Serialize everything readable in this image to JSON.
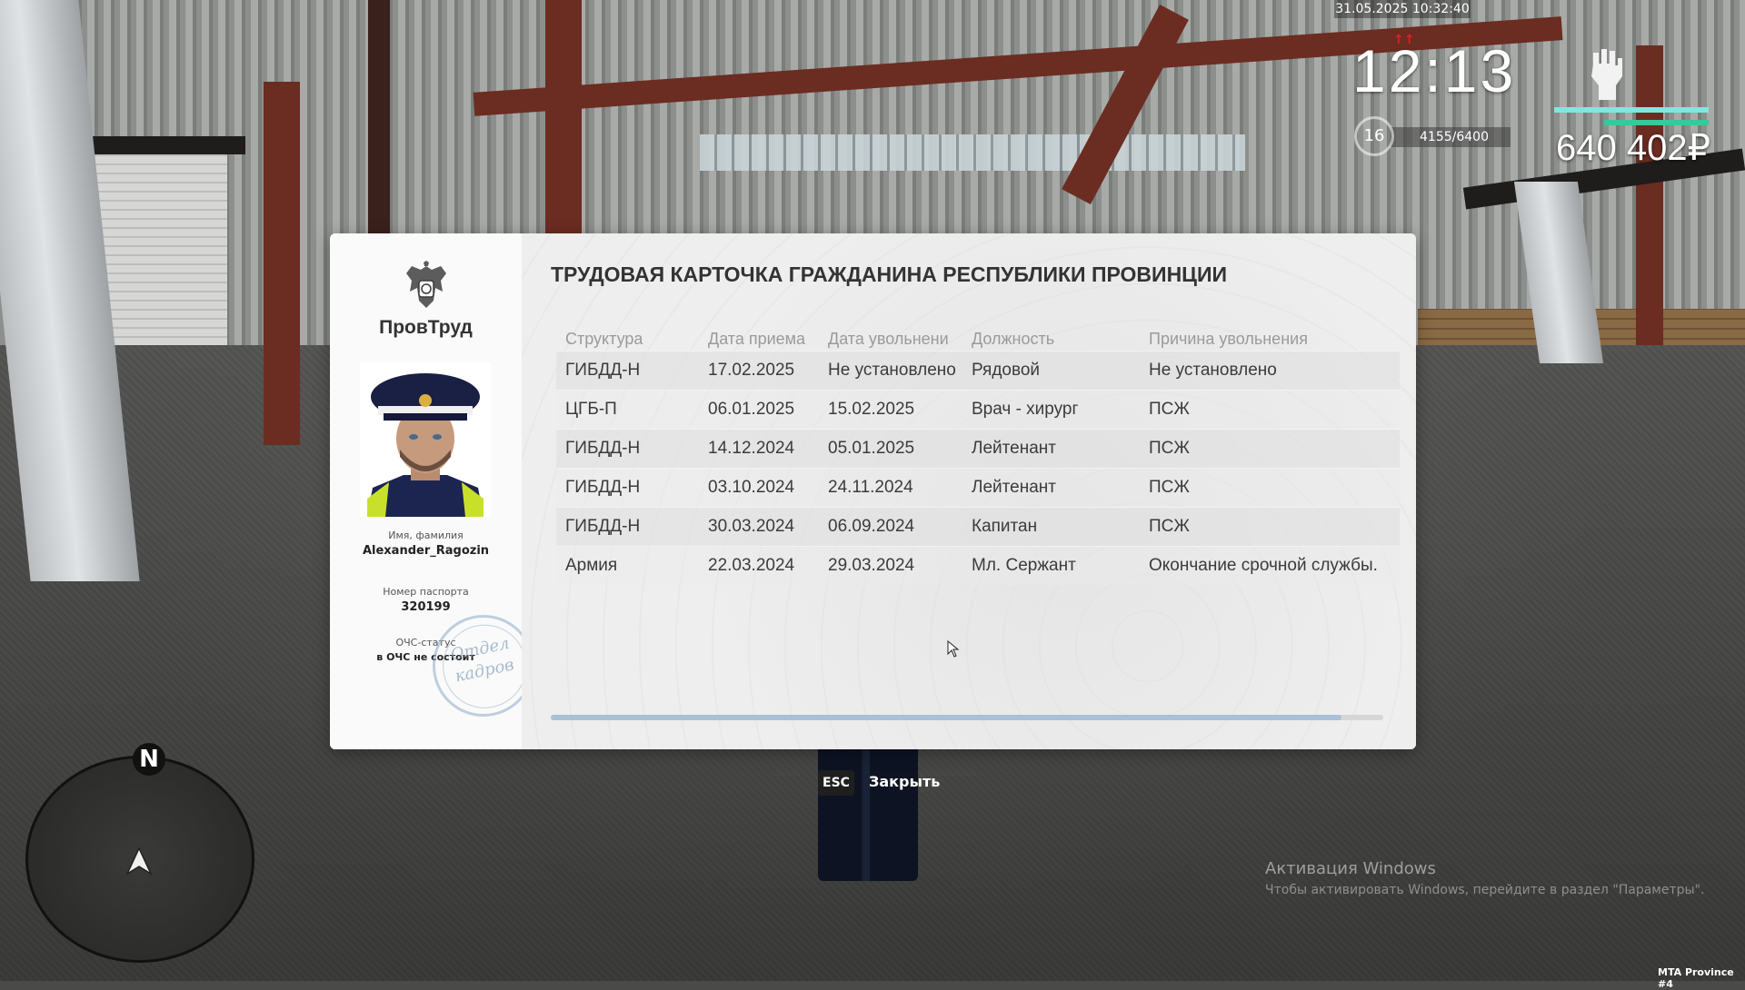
{
  "hud": {
    "datetime": "31.05.2025 10:32:40",
    "signal": "↑↑",
    "clock": "12:13",
    "level": "16",
    "xp": "4155/6400",
    "money": "640 402₽",
    "health_color": "#7fe6e0",
    "armor_color": "#38c89a",
    "status_icon": "fist-icon"
  },
  "card": {
    "org_name": "ПровТруд",
    "title": "ТРУДОВАЯ КАРТОЧКА ГРАЖДАНИНА РЕСПУБЛИКИ ПРОВИНЦИИ",
    "name_label": "Имя, фамилия",
    "name_value": "Alexander_Ragozin",
    "passport_label": "Номер паспорта",
    "passport_value": "320199",
    "status_label": "ОЧС-статус",
    "status_value": "в ОЧС не состоит",
    "stamp_text": [
      "Отдел",
      "кадров"
    ],
    "columns": [
      "Структура",
      "Дата приема",
      "Дата увольнени",
      "Должность",
      "Причина увольнения"
    ],
    "rows": [
      [
        "ГИБДД-Н",
        "17.02.2025",
        "Не установлено",
        "Рядовой",
        "Не установлено"
      ],
      [
        "ЦГБ-П",
        "06.01.2025",
        "15.02.2025",
        "Врач - хирург",
        "ПСЖ"
      ],
      [
        "ГИБДД-Н",
        "14.12.2024",
        "05.01.2025",
        "Лейтенант",
        "ПСЖ"
      ],
      [
        "ГИБДД-Н",
        "03.10.2024",
        "24.11.2024",
        "Лейтенант",
        "ПСЖ"
      ],
      [
        "ГИБДД-Н",
        "30.03.2024",
        "06.09.2024",
        "Капитан",
        "ПСЖ"
      ],
      [
        "Армия",
        "22.03.2024",
        "29.03.2024",
        "Мл. Сержант",
        "Окончание срочной службы."
      ]
    ],
    "accent_color": "#a9c0d6"
  },
  "close": {
    "key": "ESC",
    "label": "Закрыть"
  },
  "minimap": {
    "north": "N"
  },
  "watermark": {
    "title": "Активация Windows",
    "subtitle": "Чтобы активировать Windows, перейдите в раздел \"Параметры\"."
  },
  "server": "MTA Province #4"
}
